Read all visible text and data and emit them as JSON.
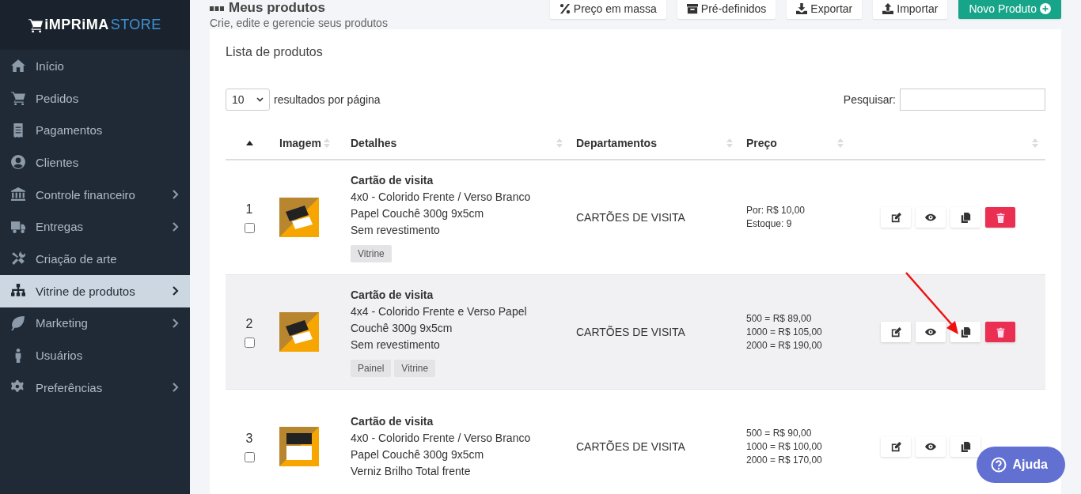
{
  "sidebar": {
    "logo": {
      "part_1": "iMPRiMA",
      "part_2": "STORE"
    },
    "items": [
      {
        "label": "Início",
        "has_submenu": false,
        "selected": false
      },
      {
        "label": "Pedidos",
        "has_submenu": false,
        "selected": false
      },
      {
        "label": "Pagamentos",
        "has_submenu": false,
        "selected": false
      },
      {
        "label": "Clientes",
        "has_submenu": false,
        "selected": false
      },
      {
        "label": "Controle financeiro",
        "has_submenu": true,
        "selected": false
      },
      {
        "label": "Entregas",
        "has_submenu": true,
        "selected": false
      },
      {
        "label": "Criação de arte",
        "has_submenu": false,
        "selected": false
      },
      {
        "label": "Vitrine de produtos",
        "has_submenu": true,
        "selected": true
      },
      {
        "label": "Marketing",
        "has_submenu": true,
        "selected": false
      },
      {
        "label": "Usuários",
        "has_submenu": false,
        "selected": false
      },
      {
        "label": "Preferências",
        "has_submenu": true,
        "selected": false
      }
    ]
  },
  "header": {
    "title": "Meus produtos",
    "subtitle": "Crie, edite e gerencie seus produtos",
    "buttons": [
      {
        "label": "Preço em massa",
        "kind": "default"
      },
      {
        "label": "Pré-definidos",
        "kind": "default"
      },
      {
        "label": "Exportar",
        "kind": "default"
      },
      {
        "label": "Importar",
        "kind": "default"
      },
      {
        "label": "Novo Produto",
        "kind": "primary"
      }
    ]
  },
  "product_list": {
    "title": "Lista de produtos",
    "page_size": "10",
    "page_size_label": "resultados por página",
    "search_label": "Pesquisar:",
    "columns": [
      {},
      {
        "label": "Imagem"
      },
      {
        "label": "Detalhes"
      },
      {
        "label": "Departamentos"
      },
      {
        "label": "Preço"
      },
      {}
    ],
    "rows": [
      {
        "number": "1",
        "checked": false,
        "highlighted": false,
        "name": "Cartão de visita",
        "lines": [
          "4x0 - Colorido Frente / Verso Branco",
          "Papel Couchê 300g 9x5cm",
          "Sem revestimento"
        ],
        "tags": [
          "Vitrine"
        ],
        "department": "CARTÕES DE VISITA",
        "price_lines": [
          "Por: R$ 10,00",
          "Estoque: 9"
        ]
      },
      {
        "number": "2",
        "checked": false,
        "highlighted": true,
        "name": "Cartão de visita",
        "lines": [
          "4x4 - Colorido Frente e Verso Papel",
          "Couchê 300g 9x5cm",
          "Sem revestimento"
        ],
        "tags": [
          "Painel",
          "Vitrine"
        ],
        "department": "CARTÕES DE VISITA",
        "price_lines": [
          "500 = R$ 89,00",
          "1000 = R$ 105,00",
          "2000 = R$ 190,00"
        ]
      },
      {
        "number": "3",
        "checked": false,
        "highlighted": false,
        "name": "Cartão de visita",
        "lines": [
          "4x0 - Colorido Frente / Verso Branco",
          "Papel Couchê 300g 9x5cm",
          "Verniz Brilho Total frente"
        ],
        "tags": [],
        "department": "CARTÕES DE VISITA",
        "price_lines": [
          "500 = R$ 90,00",
          "1000 = R$ 100,00",
          "2000 = R$ 170,00"
        ]
      }
    ]
  },
  "help_button": {
    "label": "Ajuda"
  }
}
